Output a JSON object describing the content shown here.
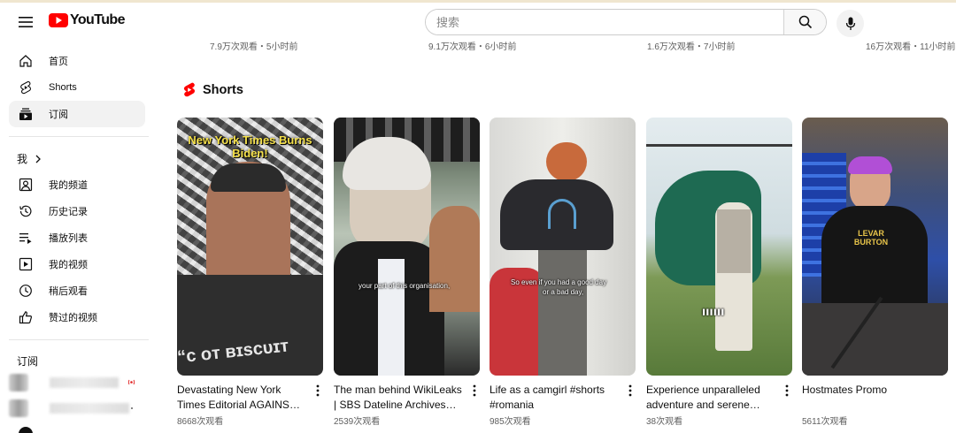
{
  "app": {
    "logo_text": "YouTube"
  },
  "search": {
    "placeholder": "搜索"
  },
  "colors": {
    "brand_red": "#ff0000",
    "active_bg": "#f2f2f2",
    "text_secondary": "#606060"
  },
  "sidebar": {
    "main": [
      {
        "label": "首页",
        "icon": "home-icon"
      },
      {
        "label": "Shorts",
        "icon": "shorts-icon"
      },
      {
        "label": "订阅",
        "icon": "subscriptions-icon",
        "active": true
      }
    ],
    "you_title": "我",
    "you": [
      {
        "label": "我的频道",
        "icon": "channel-icon"
      },
      {
        "label": "历史记录",
        "icon": "history-icon"
      },
      {
        "label": "播放列表",
        "icon": "playlist-icon"
      },
      {
        "label": "我的视频",
        "icon": "my-videos-icon"
      },
      {
        "label": "稍后观看",
        "icon": "watch-later-icon"
      },
      {
        "label": "赞过的视频",
        "icon": "liked-icon"
      }
    ],
    "subs_title": "订阅"
  },
  "top_row_stats": [
    "7.9万次观看・5小时前",
    "9.1万次观看・6小时前",
    "1.6万次观看・7小时前",
    "16万次观看・11小时前"
  ],
  "shorts": {
    "title": "Shorts",
    "items": [
      {
        "title": "Devastating New York Times Editorial AGAINST Biden",
        "views": "8668次观看",
        "overlay": "New York Times Burns Biden!"
      },
      {
        "title": "The man behind WikiLeaks | SBS Dateline Archives #shorts",
        "views": "2539次观看",
        "caption": "your part of this organisation,"
      },
      {
        "title": "Life as a camgirl #shorts #romania",
        "views": "985次观看",
        "caption": "So even if you had a good day or a bad day,"
      },
      {
        "title": "Experience unparalleled adventure and serene luxury",
        "views": "38次观看"
      },
      {
        "title": "Hostmates Promo",
        "views": "5611次观看"
      }
    ]
  }
}
